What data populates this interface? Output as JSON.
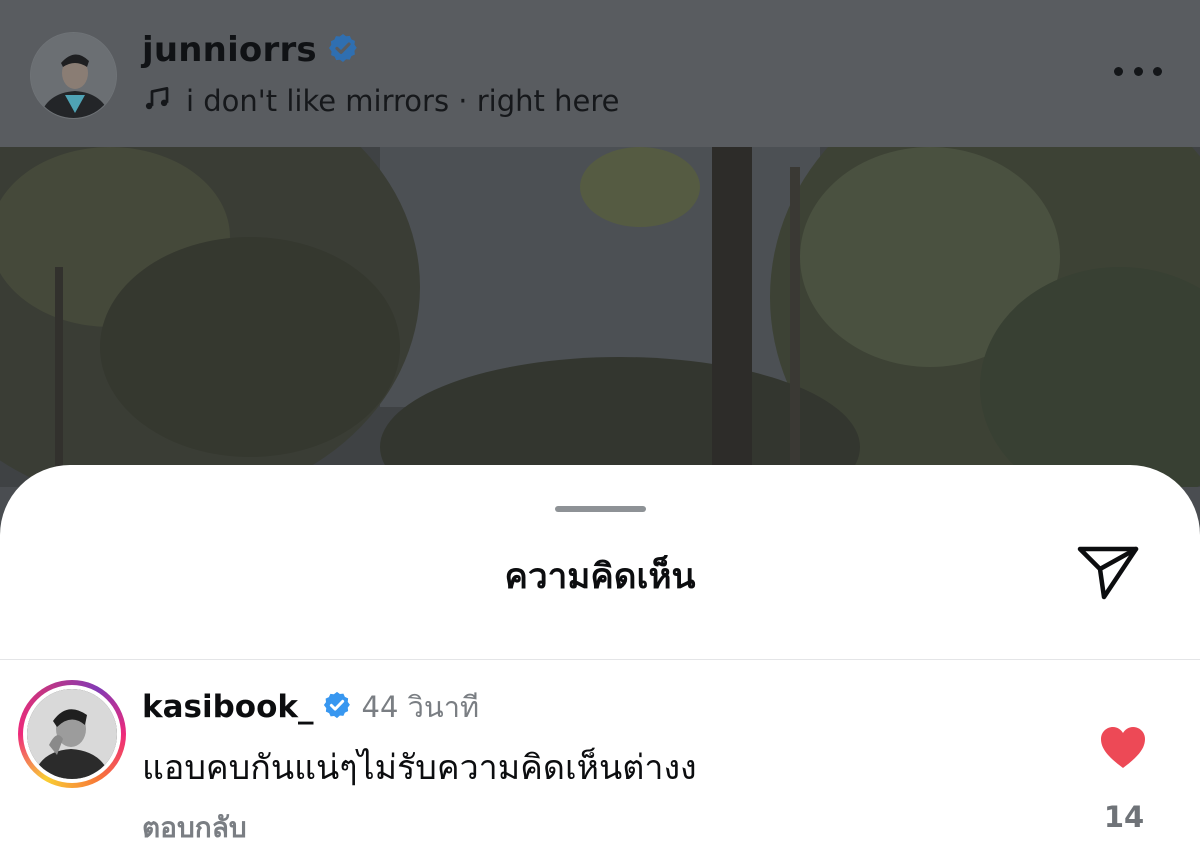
{
  "story": {
    "username": "junniorrs",
    "verified": true,
    "music": "i don't like mirrors · right here"
  },
  "comments_sheet": {
    "title": "ความคิดเห็น",
    "comments": [
      {
        "username": "kasibook_",
        "verified": true,
        "time": "44 วินาที",
        "text": "แอบคบกันแน่ๆไม่รับความคิดเห็นต่างง",
        "reply_label": "ตอบกลับ",
        "liked": true,
        "like_count": "14"
      }
    ]
  },
  "colors": {
    "verified_badge": "#3897f0",
    "like_heart": "#ed4956",
    "story_ring_start": "#f9ce34",
    "story_ring_end": "#833ab4"
  },
  "icons": [
    "music-note-icon",
    "verified-badge-icon",
    "more-options-icon",
    "share-send-icon",
    "heart-icon"
  ]
}
